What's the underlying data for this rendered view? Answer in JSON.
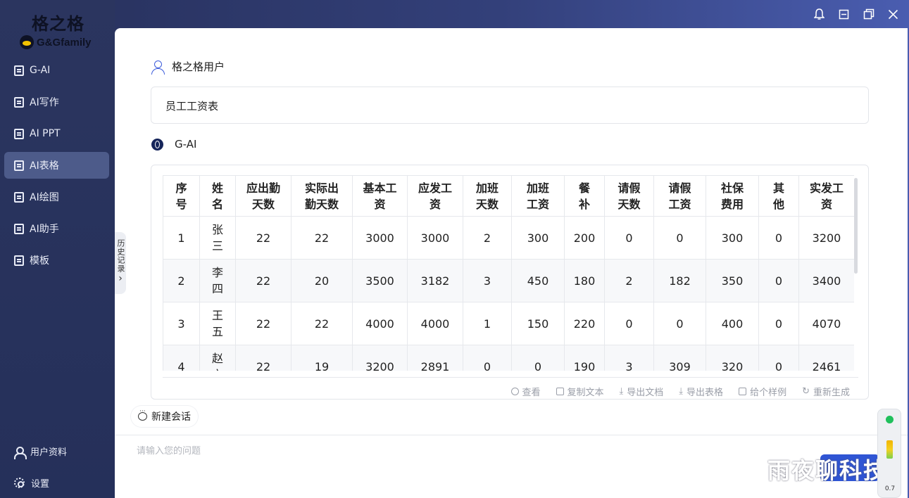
{
  "app": {
    "logo_cn": "格之格",
    "logo_en": "G&Gfamily"
  },
  "sidebar": {
    "items": [
      {
        "label": "G-AI"
      },
      {
        "label": "AI写作"
      },
      {
        "label": "AI PPT"
      },
      {
        "label": "AI表格",
        "active": true
      },
      {
        "label": "AI绘图"
      },
      {
        "label": "AI助手"
      },
      {
        "label": "模板"
      }
    ],
    "user_profile_label": "用户资料",
    "settings_label": "设置"
  },
  "history_tab": {
    "label": "历史记录",
    "chevron": "›"
  },
  "conversation": {
    "user_name": "格之格用户",
    "user_prompt": "员工工资表",
    "ai_name": "G-AI"
  },
  "table": {
    "headers": [
      [
        "序",
        "号"
      ],
      [
        "姓",
        "名"
      ],
      [
        "应出勤",
        "天数"
      ],
      [
        "实际出",
        "勤天数"
      ],
      [
        "基本工",
        "资"
      ],
      [
        "应发工",
        "资"
      ],
      [
        "加班",
        "天数"
      ],
      [
        "加班",
        "工资"
      ],
      [
        "餐",
        "补"
      ],
      [
        "请假",
        "天数"
      ],
      [
        "请假",
        "工资"
      ],
      [
        "社保",
        "费用"
      ],
      [
        "其",
        "他"
      ],
      [
        "实发工",
        "资"
      ]
    ],
    "rows": [
      [
        "1",
        "张\n三",
        "22",
        "22",
        "3000",
        "3000",
        "2",
        "300",
        "200",
        "0",
        "0",
        "300",
        "0",
        "3200"
      ],
      [
        "2",
        "李\n四",
        "22",
        "20",
        "3500",
        "3182",
        "3",
        "450",
        "180",
        "2",
        "182",
        "350",
        "0",
        "3400"
      ],
      [
        "3",
        "王\n五",
        "22",
        "22",
        "4000",
        "4000",
        "1",
        "150",
        "220",
        "0",
        "0",
        "400",
        "0",
        "4070"
      ],
      [
        "4",
        "赵\n六",
        "22",
        "19",
        "3200",
        "2891",
        "0",
        "0",
        "190",
        "3",
        "309",
        "320",
        "0",
        "2461"
      ]
    ]
  },
  "actions": {
    "view": "查看",
    "copy_text": "复制文本",
    "export_doc": "导出文档",
    "export_table": "导出表格",
    "sample": "给个样例",
    "regenerate": "重新生成"
  },
  "new_chat_label": "新建会话",
  "input": {
    "placeholder": "请输入您的问题"
  },
  "watermark": "雨夜聊科技",
  "widget": {
    "value": "0.7"
  }
}
